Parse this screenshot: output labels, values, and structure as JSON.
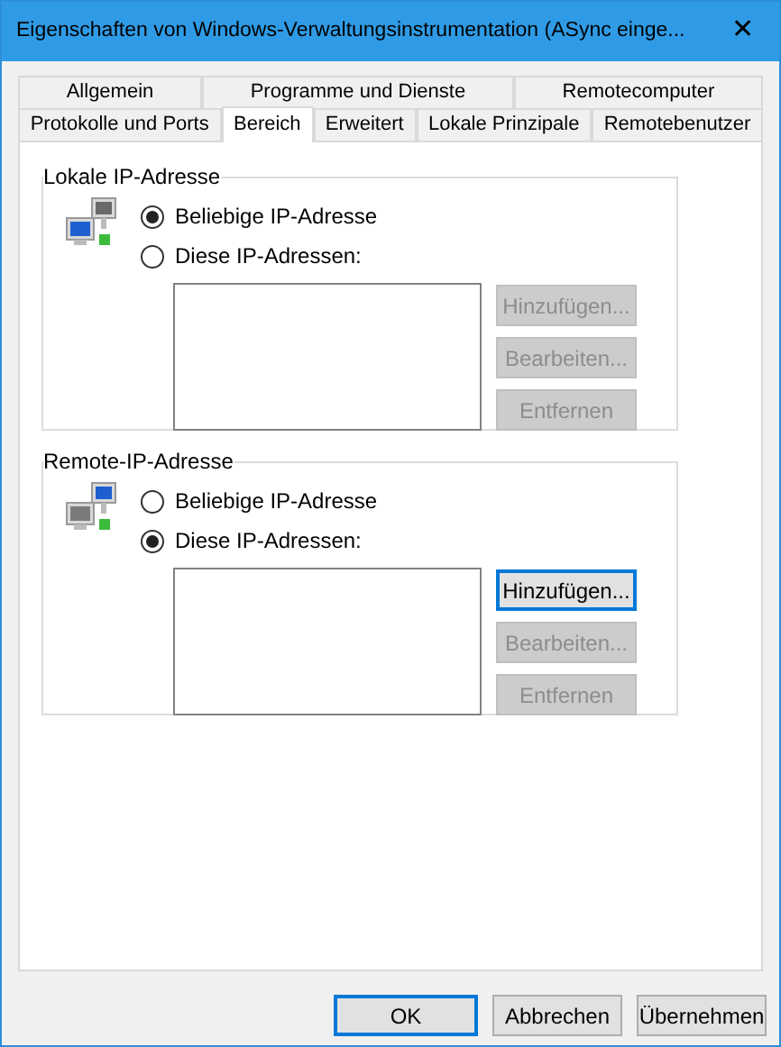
{
  "window": {
    "title": "Eigenschaften von Windows-Verwaltungsinstrumentation (ASync einge...",
    "close": "✕"
  },
  "tab_rows": [
    [
      {
        "label": "Allgemein",
        "selected": false
      },
      {
        "label": "Programme und Dienste",
        "selected": false
      },
      {
        "label": "Remotecomputer",
        "selected": false
      }
    ],
    [
      {
        "label": "Protokolle und Ports",
        "selected": false
      },
      {
        "label": "Bereich",
        "selected": true
      },
      {
        "label": "Erweitert",
        "selected": false
      },
      {
        "label": "Lokale Prinzipale",
        "selected": false
      },
      {
        "label": "Remotebenutzer",
        "selected": false
      }
    ]
  ],
  "groups": [
    {
      "title": "Lokale IP-Adresse",
      "kind": "local",
      "options": [
        {
          "label": "Beliebige IP-Adresse",
          "selected": true
        },
        {
          "label": "Diese IP-Adressen:",
          "selected": false
        }
      ],
      "buttons": [
        {
          "label": "Hinzufügen...",
          "disabled": true
        },
        {
          "label": "Bearbeiten...",
          "disabled": true
        },
        {
          "label": "Entfernen",
          "disabled": true
        }
      ]
    },
    {
      "title": "Remote-IP-Adresse",
      "kind": "remote",
      "options": [
        {
          "label": "Beliebige IP-Adresse",
          "selected": false
        },
        {
          "label": "Diese IP-Adressen:",
          "selected": true
        }
      ],
      "buttons": [
        {
          "label": "Hinzufügen...",
          "disabled": false,
          "focused": true
        },
        {
          "label": "Bearbeiten...",
          "disabled": true
        },
        {
          "label": "Entfernen",
          "disabled": true
        }
      ]
    }
  ],
  "footer_buttons": [
    {
      "label": "OK",
      "focused": true
    },
    {
      "label": "Abbrechen",
      "focused": false
    },
    {
      "label": "Übernehmen",
      "focused": false
    }
  ]
}
